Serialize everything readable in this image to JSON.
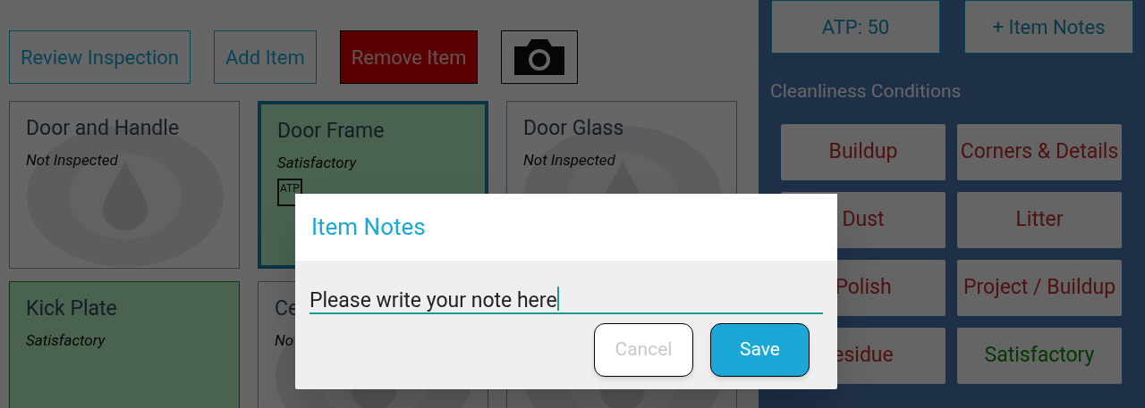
{
  "toolbar": [
    {
      "label": "Review Inspection",
      "kind": "outline"
    },
    {
      "label": "Add Item",
      "kind": "outline"
    },
    {
      "label": "Remove Item",
      "kind": "danger"
    },
    {
      "kind": "camera"
    }
  ],
  "items": [
    {
      "title": "Door and Handle",
      "status": "Not Inspected",
      "kind": "not_inspected",
      "selected": false
    },
    {
      "title": "Door Frame",
      "status": "Satisfactory",
      "kind": "satisfactory",
      "selected": true,
      "badge": "ATP"
    },
    {
      "title": "Door Glass",
      "status": "Not Inspected",
      "kind": "not_inspected",
      "selected": false
    },
    {
      "title": "Kick Plate",
      "status": "Satisfactory",
      "kind": "satisfactory",
      "selected": false
    },
    {
      "title": "Ce",
      "status": "No",
      "kind": "not_inspected",
      "selected": false
    },
    {
      "kind": "not_inspected",
      "selected": false
    }
  ],
  "side_panel": {
    "buttons": [
      "ATP: 50",
      "+ Item Notes"
    ],
    "heading": "Cleanliness Conditions",
    "conditions": [
      {
        "label": "Buildup",
        "kind": "issue"
      },
      {
        "label": "Corners & Details",
        "kind": "issue"
      },
      {
        "label": "Dust",
        "kind": "issue"
      },
      {
        "label": "Litter",
        "kind": "issue"
      },
      {
        "label": "Polish",
        "kind": "issue"
      },
      {
        "label": "Project / Buildup",
        "kind": "issue"
      },
      {
        "label": "esidue",
        "kind": "issue"
      },
      {
        "label": "Satisfactory",
        "kind": "ok"
      }
    ]
  },
  "dialog": {
    "title": "Item Notes",
    "value": "Please write your note here",
    "buttons": [
      {
        "label": "Cancel",
        "kind": "secondary"
      },
      {
        "label": "Save",
        "kind": "primary"
      }
    ]
  }
}
